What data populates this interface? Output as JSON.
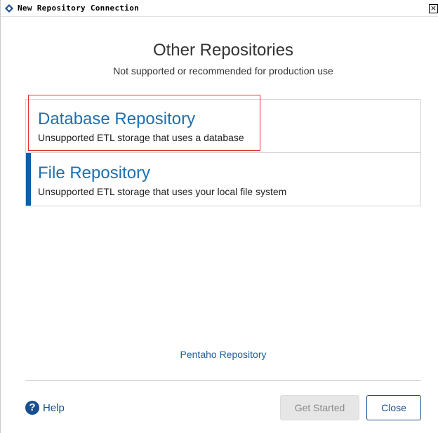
{
  "window": {
    "title": "New Repository Connection",
    "close_glyph": "×",
    "app_icon": "pentaho-diamond-icon"
  },
  "header": {
    "title": "Other Repositories",
    "subtitle": "Not supported or recommended for production use"
  },
  "repositories": [
    {
      "name": "Database Repository",
      "description": "Unsupported ETL storage that uses a database"
    },
    {
      "name": "File Repository",
      "description": "Unsupported ETL storage that uses your local file system"
    }
  ],
  "footer": {
    "pentaho_link": "Pentaho Repository",
    "help_icon_glyph": "?",
    "help_label": "Help",
    "get_started_label": "Get Started",
    "close_label": "Close"
  },
  "colors": {
    "accent": "#0f5fa8",
    "link": "#1f6fad",
    "highlight": "#e03030",
    "disabled_button": "#e6e6e6"
  }
}
